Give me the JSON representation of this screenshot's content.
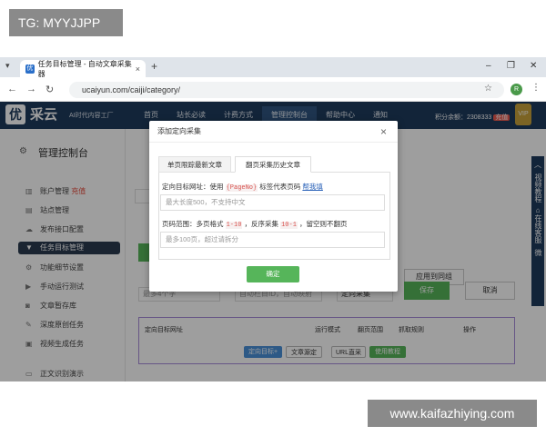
{
  "watermarks": {
    "top": "TG: MYYJJPP",
    "bottom": "www.kaifazhiying.com"
  },
  "browser": {
    "tab_title": "任务目标管理 - 自动文章采集器",
    "tab_close": "×",
    "new_tab": "+",
    "url": "ucaiyun.com/caiji/category/",
    "profile_initial": "R"
  },
  "site": {
    "logo_char": "优",
    "logo_text": "采云",
    "logo_sub": "AI时代内容工厂",
    "nav": [
      "首页",
      "站长必读",
      "计费方式",
      "管理控制台",
      "帮助中心",
      "通知"
    ],
    "credits_label": "积分余额：2308333",
    "credits_tag": "充值",
    "vip": "VIP"
  },
  "sidebar": {
    "title": "管理控制台",
    "items": [
      {
        "label": "账户管理",
        "extra": "充值",
        "icon": "bar-chart-icon"
      },
      {
        "label": "站点管理",
        "icon": "page-icon"
      },
      {
        "label": "发布接口配置",
        "icon": "cloud-upload-icon"
      },
      {
        "label": "任务目标管理",
        "icon": "filter-icon",
        "active": true
      },
      {
        "label": "功能细节设置",
        "icon": "gear-icon"
      },
      {
        "label": "手动运行测试",
        "icon": "play-icon"
      },
      {
        "label": "文章暂存库",
        "icon": "database-icon"
      },
      {
        "label": "深度原创任务",
        "icon": "edit-icon"
      },
      {
        "label": "视频生成任务",
        "icon": "video-icon"
      },
      {
        "label": "正文识别演示",
        "icon": "monitor-icon"
      }
    ]
  },
  "main": {
    "bg_input1": "最多4个字",
    "bg_input2": "自动栏目ID，自动映射",
    "bg_select": "定向采集",
    "btn_apply_group": "应用到同组",
    "btn_save": "保存",
    "btn_cancel": "取消",
    "table_headers": [
      "定向目标网址",
      "运行模式",
      "翻页范围",
      "抓取规则",
      "操作"
    ],
    "table_buttons": [
      "定向目标+",
      "文章源定",
      "URL直采",
      "使用教程"
    ]
  },
  "floatbar": {
    "items": [
      "视频教程",
      "在线客服",
      "微"
    ]
  },
  "modal": {
    "title": "添加定向采集",
    "close": "×",
    "tabs": [
      "单页限踪最新文章",
      "翻页采集历史文章"
    ],
    "active_tab": 1,
    "url_label_prefix": "定向目标网址：使用",
    "url_label_code": "{PageNo}",
    "url_label_suffix": "标签代表页码",
    "url_help_link": "帮我填",
    "url_placeholder": "最大长度500，不支持中文",
    "range_label_prefix": "页码范围：多页格式",
    "range_code1": "1-10",
    "range_label_mid": "，反序采集",
    "range_code2": "10-1",
    "range_label_suffix": "，留空则不翻页",
    "range_placeholder": "最多100页，超过请拆分",
    "confirm": "确定"
  }
}
